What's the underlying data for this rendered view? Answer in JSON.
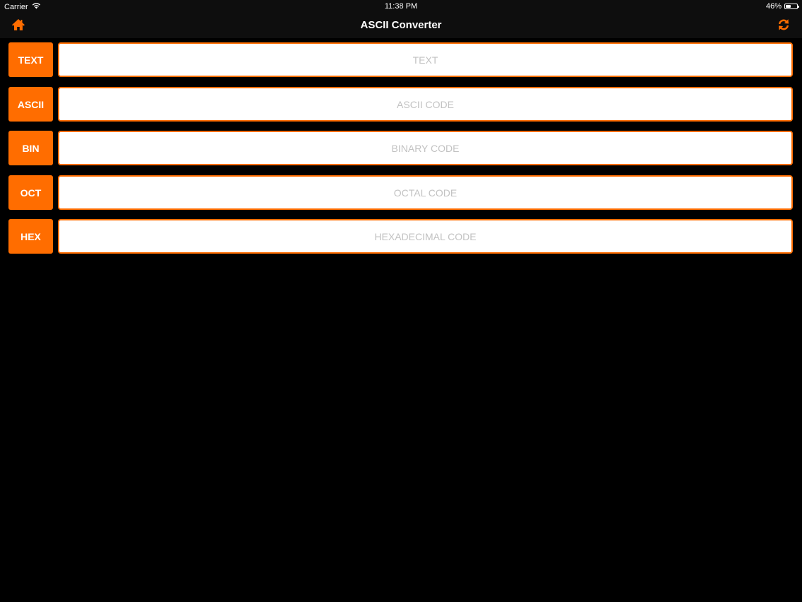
{
  "status_bar": {
    "carrier": "Carrier",
    "time": "11:38 PM",
    "battery_text": "46%",
    "battery_level": 0.46
  },
  "nav": {
    "title": "ASCII Converter",
    "left_icon": "home-icon",
    "right_icon": "convert-icon",
    "accent": "#ff6d00"
  },
  "rows": [
    {
      "label": "TEXT",
      "placeholder": "TEXT",
      "value": ""
    },
    {
      "label": "ASCII",
      "placeholder": "ASCII CODE",
      "value": ""
    },
    {
      "label": "BIN",
      "placeholder": "BINARY CODE",
      "value": ""
    },
    {
      "label": "OCT",
      "placeholder": "OCTAL CODE",
      "value": ""
    },
    {
      "label": "HEX",
      "placeholder": "HEXADECIMAL CODE",
      "value": ""
    }
  ],
  "colors": {
    "accent": "#ff6d00",
    "background": "#000000",
    "bar": "#0e0e0e",
    "placeholder": "#c2c2c2"
  }
}
